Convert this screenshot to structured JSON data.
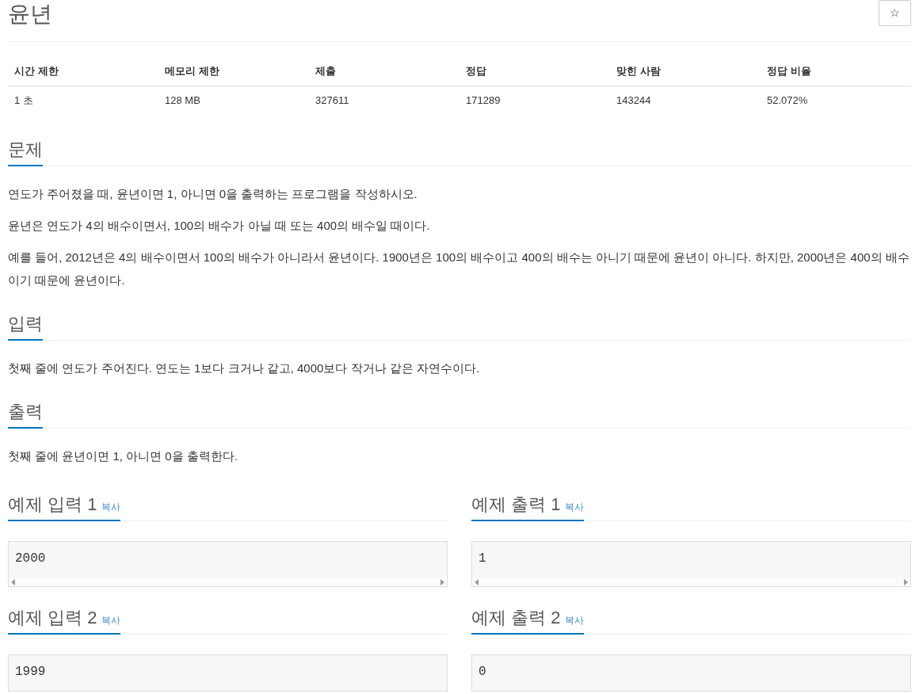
{
  "title": "윤년",
  "star_button": "☆",
  "info_table": {
    "columns": [
      "시간 제한",
      "메모리 제한",
      "제출",
      "정답",
      "맞힌 사람",
      "정답 비율"
    ],
    "rows": [
      [
        "1 초",
        "128 MB",
        "327611",
        "171289",
        "143244",
        "52.072%"
      ]
    ]
  },
  "sections": [
    {
      "heading": "문제",
      "paragraphs": [
        "연도가 주어졌을 때, 윤년이면 1, 아니면 0을 출력하는 프로그램을 작성하시오.",
        "윤년은 연도가 4의 배수이면서, 100의 배수가 아닐 때 또는 400의 배수일 때이다.",
        "예를 들어, 2012년은 4의 배수이면서 100의 배수가 아니라서 윤년이다. 1900년은 100의 배수이고 400의 배수는 아니기 때문에 윤년이 아니다. 하지만, 2000년은 400의 배수이기 때문에 윤년이다."
      ]
    },
    {
      "heading": "입력",
      "paragraphs": [
        "첫째 줄에 연도가 주어진다. 연도는 1보다 크거나 같고, 4000보다 작거나 같은 자연수이다."
      ]
    },
    {
      "heading": "출력",
      "paragraphs": [
        "첫째 줄에 윤년이면 1, 아니면 0을 출력한다."
      ]
    }
  ],
  "samples": [
    {
      "heading": "예제 입력 1",
      "copy": "복사",
      "content": "2000",
      "scrollbar": true
    },
    {
      "heading": "예제 출력 1",
      "copy": "복사",
      "content": "1",
      "scrollbar": true
    },
    {
      "heading": "예제 입력 2",
      "copy": "복사",
      "content": "1999",
      "scrollbar": false
    },
    {
      "heading": "예제 출력 2",
      "copy": "복사",
      "content": "0",
      "scrollbar": false
    }
  ]
}
